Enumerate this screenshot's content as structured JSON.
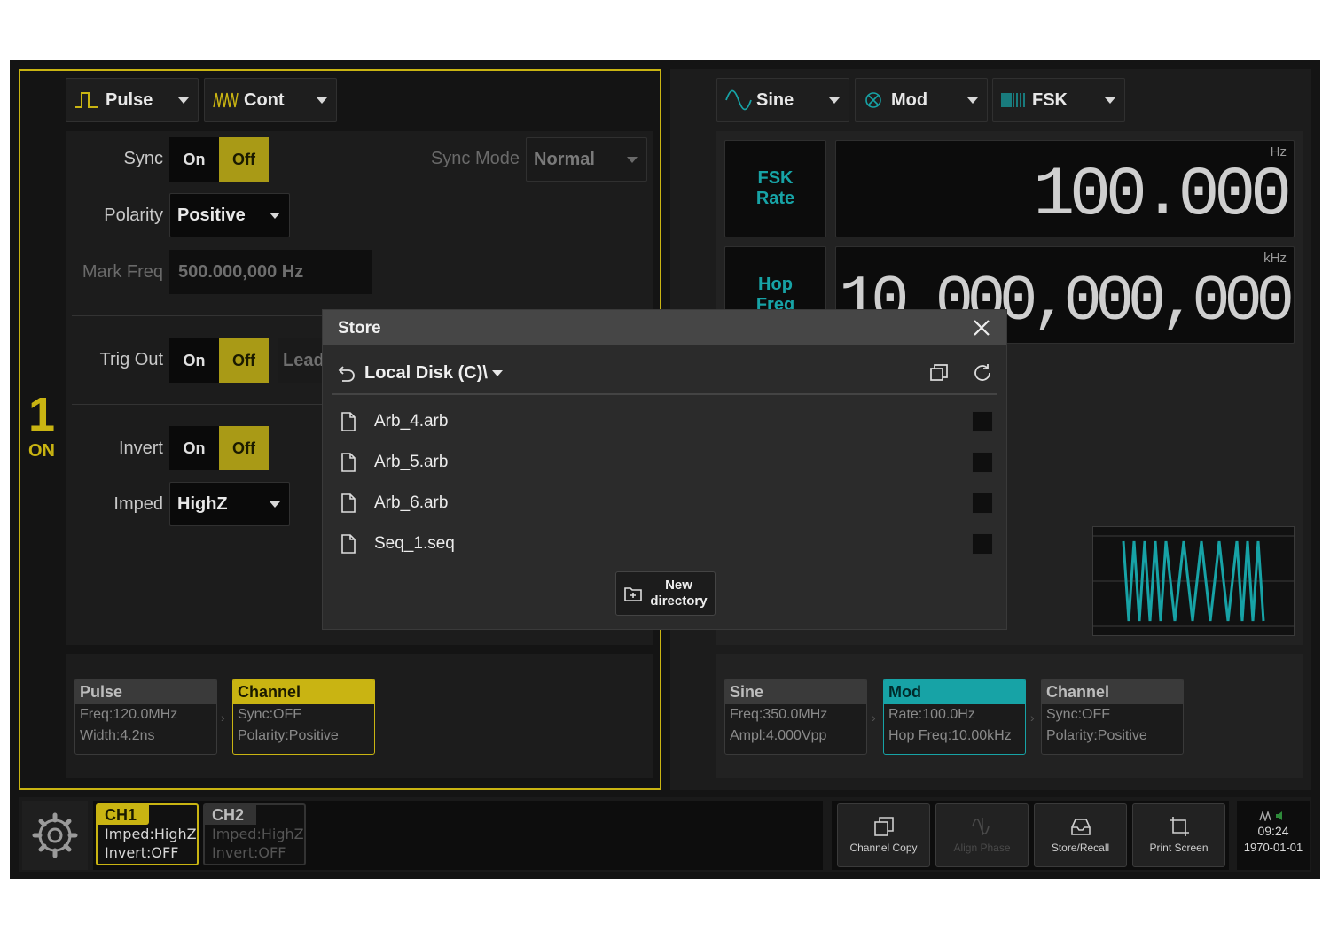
{
  "ch1": {
    "waveform": "Pulse",
    "mode": "Cont",
    "sync_label": "Sync",
    "on": "On",
    "off": "Off",
    "sync_mode_label": "Sync Mode",
    "sync_mode_value": "Normal",
    "polarity_label": "Polarity",
    "polarity_value": "Positive",
    "mark_freq_label": "Mark Freq",
    "mark_freq_value": "500.000,000 Hz",
    "trig_out_label": "Trig Out",
    "trig_lead_partial": "Lead",
    "invert_label": "Invert",
    "imped_label": "Imped",
    "imped_value": "HighZ",
    "badge_num": "1",
    "badge_state": "ON",
    "cards": [
      {
        "title": "Pulse",
        "line1": "Freq:120.0MHz",
        "line2": "Width:4.2ns"
      },
      {
        "title": "Channel",
        "line1": "Sync:OFF",
        "line2": "Polarity:Positive"
      }
    ]
  },
  "ch2": {
    "waveform": "Sine",
    "mode": "Mod",
    "mod_type": "FSK",
    "fsk_rate_label": [
      "FSK",
      "Rate"
    ],
    "fsk_rate_unit": "Hz",
    "fsk_rate_value": "100.000",
    "hop_freq_label": [
      "Hop",
      "Freq"
    ],
    "hop_freq_unit": "kHz",
    "hop_freq_value": "10.000,000,000",
    "cards": [
      {
        "title": "Sine",
        "line1": "Freq:350.0MHz",
        "line2": "Ampl:4.000Vpp"
      },
      {
        "title": "Mod",
        "line1": "Rate:100.0Hz",
        "line2": "Hop Freq:10.00kHz"
      },
      {
        "title": "Channel",
        "line1": "Sync:OFF",
        "line2": "Polarity:Positive"
      }
    ]
  },
  "dialog": {
    "title": "Store",
    "path": "Local Disk (C)\\",
    "files": [
      "Arb_4.arb",
      "Arb_5.arb",
      "Arb_6.arb",
      "Seq_1.seq"
    ],
    "new_dir_line1": "New",
    "new_dir_line2": "directory"
  },
  "status": {
    "ch1": {
      "label": "CH1",
      "imped": "Imped:HighZ",
      "invert": "Invert:OFF"
    },
    "ch2": {
      "label": "CH2",
      "imped": "Imped:HighZ",
      "invert": "Invert:OFF"
    }
  },
  "toolbar": {
    "channel_copy": "Channel Copy",
    "align_phase": "Align Phase",
    "store_recall": "Store/Recall",
    "print_screen": "Print Screen"
  },
  "clock": {
    "time": "09:24",
    "date": "1970-01-01"
  },
  "colors": {
    "ch1_accent": "#c9b412",
    "ch2_accent": "#17a3a6",
    "background": "#141414"
  }
}
